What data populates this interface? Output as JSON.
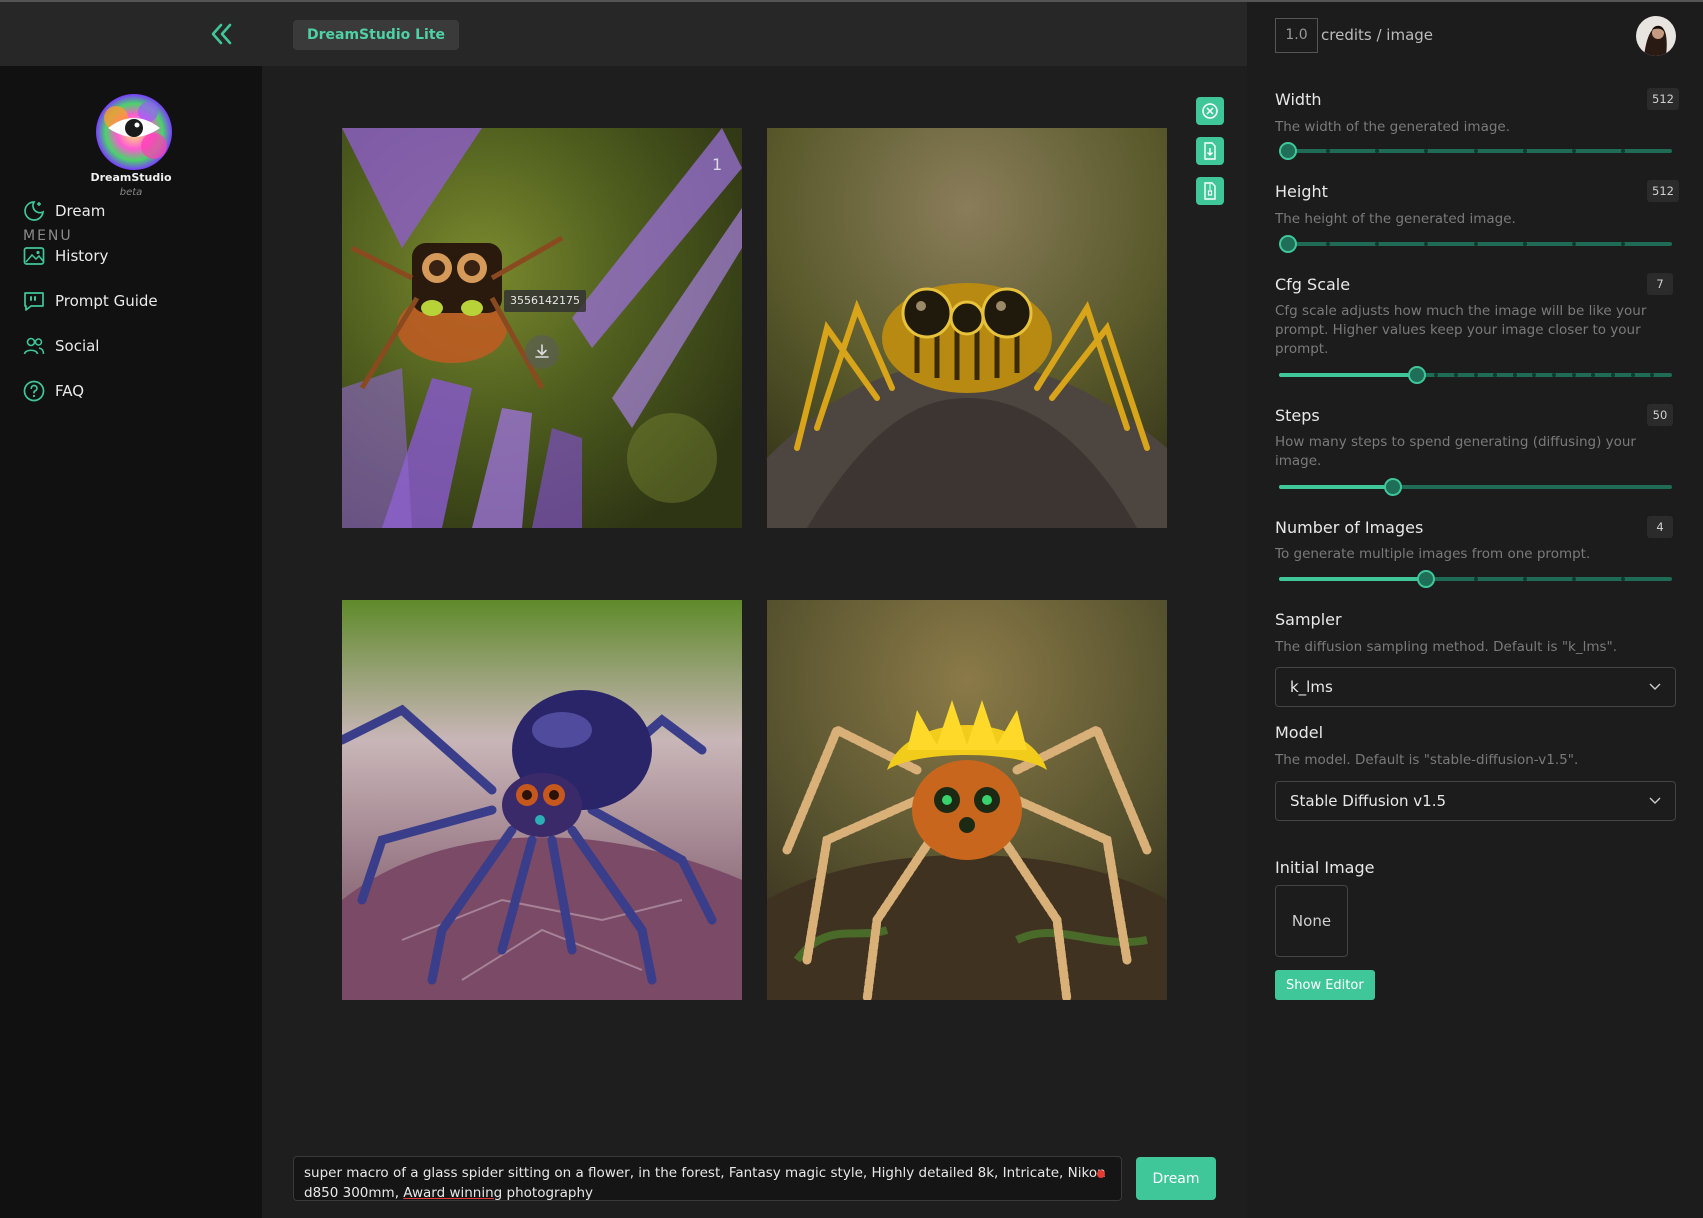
{
  "header": {
    "badge": "DreamStudio Lite",
    "credits_value": "1.0",
    "credits_label": "credits / image"
  },
  "sidebar": {
    "brand": "DreamStudio",
    "brand_sub": "beta",
    "menu_title": "MENU",
    "items": [
      {
        "label": "Dream",
        "icon": "moon-stars-icon"
      },
      {
        "label": "History",
        "icon": "image-gallery-icon"
      },
      {
        "label": "Prompt Guide",
        "icon": "quote-bubble-icon"
      },
      {
        "label": "Social",
        "icon": "users-icon"
      },
      {
        "label": "FAQ",
        "icon": "question-circle-icon"
      }
    ]
  },
  "main": {
    "images": [
      {
        "subject": "spider on purple flower with watermark"
      },
      {
        "subject": "yellow spider on rock"
      },
      {
        "subject": "glass purple spider on leaf"
      },
      {
        "subject": "yellow-crowned spider on moss"
      }
    ],
    "seed_tooltip": "3556142175",
    "prompt_text_a": "super macro of a glass spider sitting on a flower, in the forest, Fantasy magic style, Highly detailed 8k, Intricate, Nikon d850 300mm, ",
    "prompt_text_b": "Award winning",
    "prompt_text_c": " photography",
    "dream_button": "Dream"
  },
  "panel": {
    "width": {
      "label": "Width",
      "desc": "The width of the generated image.",
      "value": "512",
      "level": 0.0
    },
    "height": {
      "label": "Height",
      "desc": "The height of the generated image.",
      "value": "512",
      "level": 0.0
    },
    "cfg": {
      "label": "Cfg Scale",
      "desc": "Cfg scale adjusts how much the image will be like your prompt. Higher values keep your image closer to your prompt.",
      "value": "7",
      "level": 0.35
    },
    "steps": {
      "label": "Steps",
      "desc": "How many steps to spend generating (diffusing) your image.",
      "value": "50",
      "level": 0.29
    },
    "num_images": {
      "label": "Number of Images",
      "desc": "To generate multiple images from one prompt.",
      "value": "4",
      "level": 0.375
    },
    "sampler": {
      "label": "Sampler",
      "desc": "The diffusion sampling method. Default is \"k_lms\".",
      "value": "k_lms"
    },
    "model": {
      "label": "Model",
      "desc": "The model. Default is \"stable-diffusion-v1.5\".",
      "value": "Stable Diffusion v1.5"
    },
    "initial_image": {
      "label": "Initial Image",
      "value": "None"
    },
    "show_editor": "Show Editor"
  },
  "colors": {
    "accent": "#3fc79a",
    "sidebar_bg": "#111111",
    "main_bg": "#1e1e1e"
  }
}
